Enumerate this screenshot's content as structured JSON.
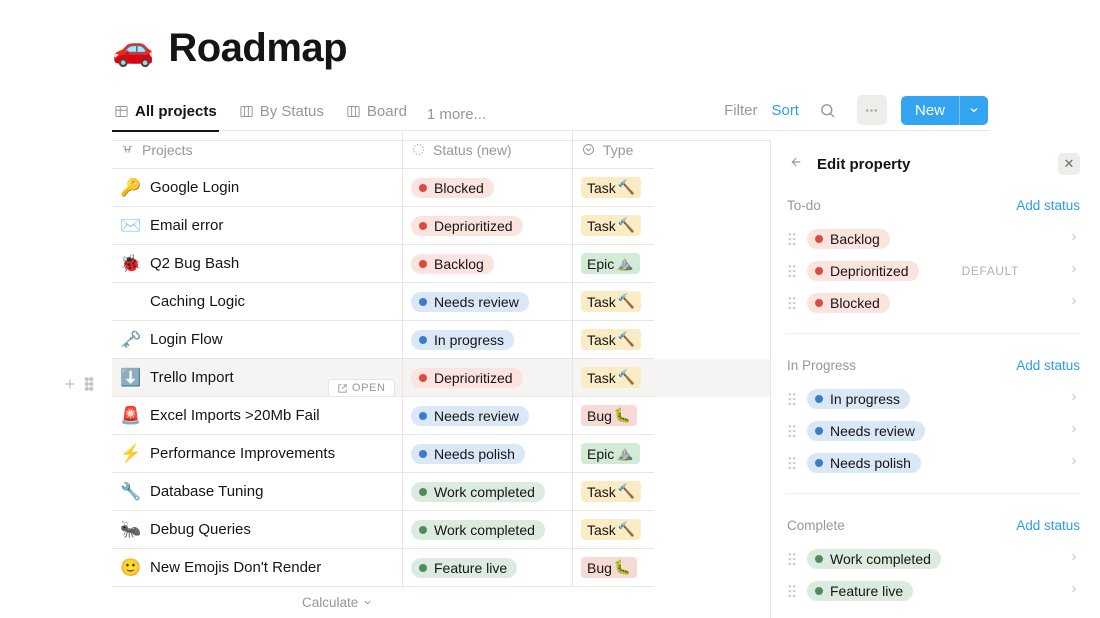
{
  "title": {
    "emoji": "🚗",
    "text": "Roadmap"
  },
  "tabs": {
    "t0": {
      "label": "All projects"
    },
    "t1": {
      "label": "By Status"
    },
    "t2": {
      "label": "Board"
    },
    "more": "1 more..."
  },
  "toolbar": {
    "filter": "Filter",
    "sort": "Sort",
    "new": "New"
  },
  "headers": {
    "projects": "Projects",
    "status": "Status (new)",
    "type": "Type"
  },
  "rows": [
    {
      "emoji": "🔑",
      "name": "Google Login",
      "status": {
        "label": "Blocked",
        "color": "red"
      },
      "type": {
        "label": "Task",
        "emoji": "🔨",
        "color": "yellow"
      }
    },
    {
      "emoji": "✉️",
      "name": "Email error",
      "status": {
        "label": "Deprioritized",
        "color": "red"
      },
      "type": {
        "label": "Task",
        "emoji": "🔨",
        "color": "yellow"
      }
    },
    {
      "emoji": "🐞",
      "name": "Q2 Bug Bash",
      "status": {
        "label": "Backlog",
        "color": "red"
      },
      "type": {
        "label": "Epic",
        "emoji": "⛰️",
        "color": "green"
      }
    },
    {
      "emoji": "",
      "name": "Caching Logic",
      "status": {
        "label": "Needs review",
        "color": "blue"
      },
      "type": {
        "label": "Task",
        "emoji": "🔨",
        "color": "yellow"
      }
    },
    {
      "emoji": "🗝️",
      "name": "Login Flow",
      "status": {
        "label": "In progress",
        "color": "blue"
      },
      "type": {
        "label": "Task",
        "emoji": "🔨",
        "color": "yellow"
      }
    },
    {
      "emoji": "⬇️",
      "name": "Trello Import",
      "status": {
        "label": "Deprioritized",
        "color": "red"
      },
      "type": {
        "label": "Task",
        "emoji": "🔨",
        "color": "yellow"
      }
    },
    {
      "emoji": "🚨",
      "name": "Excel Imports >20Mb Fail",
      "status": {
        "label": "Needs review",
        "color": "blue"
      },
      "type": {
        "label": "Bug",
        "emoji": "🐛",
        "color": "red"
      }
    },
    {
      "emoji": "⚡",
      "name": "Performance Improvements",
      "status": {
        "label": "Needs polish",
        "color": "blue"
      },
      "type": {
        "label": "Epic",
        "emoji": "⛰️",
        "color": "green"
      }
    },
    {
      "emoji": "🔧",
      "name": "Database Tuning",
      "status": {
        "label": "Work completed",
        "color": "green"
      },
      "type": {
        "label": "Task",
        "emoji": "🔨",
        "color": "yellow"
      }
    },
    {
      "emoji": "🐜",
      "name": "Debug Queries",
      "status": {
        "label": "Work completed",
        "color": "green"
      },
      "type": {
        "label": "Task",
        "emoji": "🔨",
        "color": "yellow"
      }
    },
    {
      "emoji": "🙂",
      "name": "New Emojis Don't Render",
      "status": {
        "label": "Feature live",
        "color": "green"
      },
      "type": {
        "label": "Bug",
        "emoji": "🐛",
        "color": "red"
      }
    }
  ],
  "open_label": "OPEN",
  "calc": "Calculate",
  "panel": {
    "title": "Edit property",
    "add": "Add status",
    "default": "DEFAULT",
    "sections": [
      {
        "name": "To-do",
        "items": [
          {
            "label": "Backlog",
            "color": "red"
          },
          {
            "label": "Deprioritized",
            "color": "red",
            "default": true
          },
          {
            "label": "Blocked",
            "color": "red"
          }
        ]
      },
      {
        "name": "In Progress",
        "items": [
          {
            "label": "In progress",
            "color": "blue"
          },
          {
            "label": "Needs review",
            "color": "blue"
          },
          {
            "label": "Needs polish",
            "color": "blue"
          }
        ]
      },
      {
        "name": "Complete",
        "items": [
          {
            "label": "Work completed",
            "color": "green"
          },
          {
            "label": "Feature live",
            "color": "green"
          }
        ]
      }
    ]
  }
}
